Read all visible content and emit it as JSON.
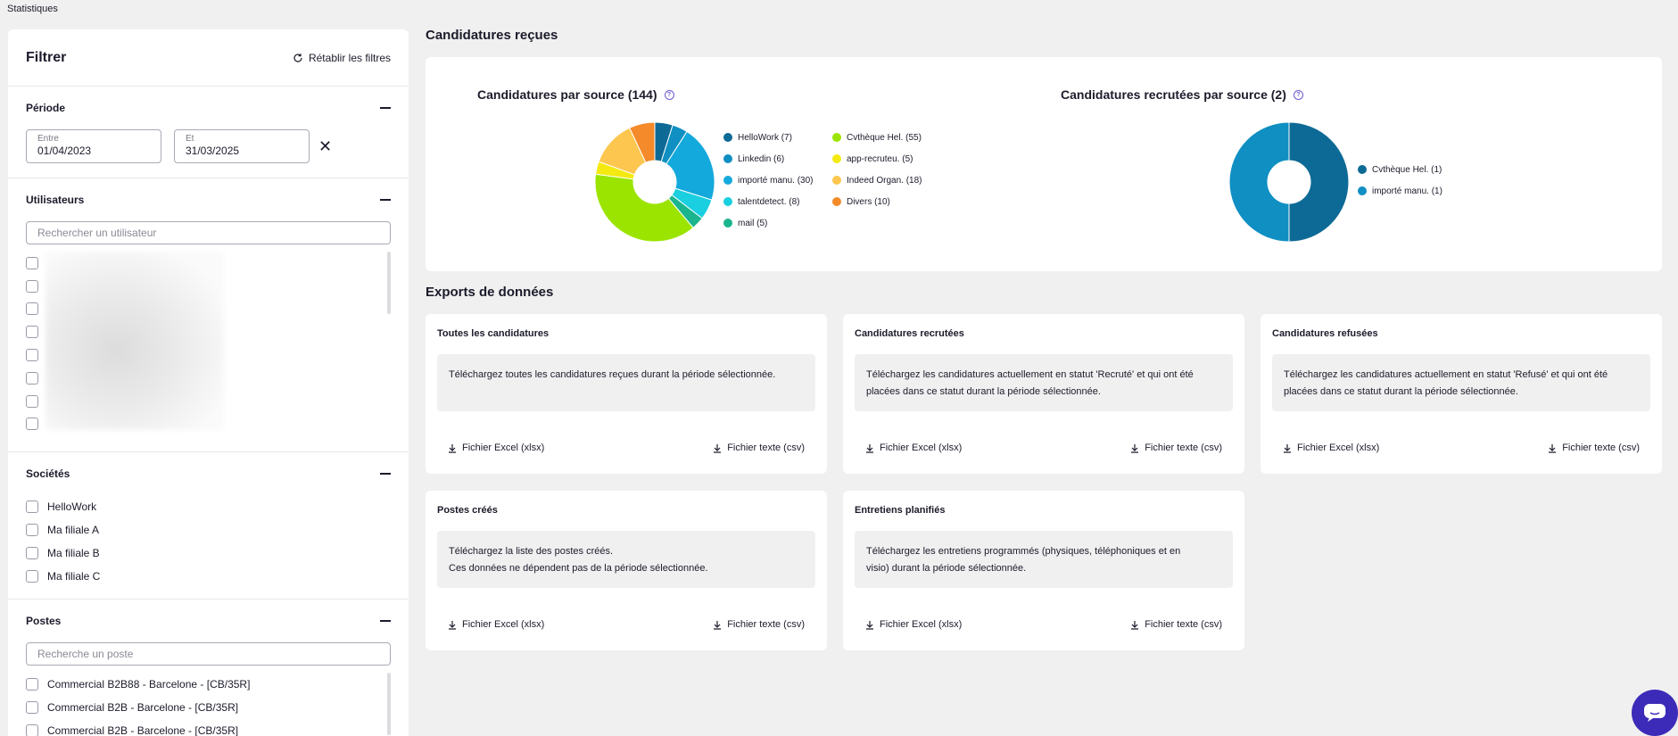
{
  "app": {
    "title": "Statistiques"
  },
  "filters": {
    "title": "Filtrer",
    "reset_label": "Rétablir les filtres",
    "period": {
      "title": "Période",
      "start_label": "Entre",
      "start_value": "01/04/2023",
      "end_label": "Et",
      "end_value": "31/03/2025"
    },
    "users": {
      "title": "Utilisateurs",
      "search_placeholder": "Rechercher un utilisateur"
    },
    "companies": {
      "title": "Sociétés",
      "items": [
        "HelloWork",
        "Ma filiale A",
        "Ma filiale B",
        "Ma filiale C"
      ]
    },
    "postes": {
      "title": "Postes",
      "search_placeholder": "Recherche un poste",
      "items": [
        "Commercial B2B88 - Barcelone - [CB/35R]",
        "Commercial B2B - Barcelone - [CB/35R]",
        "Commercial B2B - Barcelone - [CB/35R]"
      ]
    }
  },
  "received": {
    "section_title": "Candidatures reçues",
    "by_source_title": "Candidatures par source (144)",
    "recruited_title": "Candidatures recrutées par source (2)"
  },
  "exports": {
    "section_title": "Exports de données",
    "excel_label": "Fichier Excel (xlsx)",
    "csv_label": "Fichier texte (csv)",
    "cards": [
      {
        "title": "Toutes les candidatures",
        "desc1": "Téléchargez toutes les candidatures reçues durant la période sélectionnée.",
        "desc2": ""
      },
      {
        "title": "Candidatures recrutées",
        "desc1": "Téléchargez les candidatures actuellement en statut 'Recruté' et qui ont été",
        "desc2": "placées dans ce statut durant la période sélectionnée."
      },
      {
        "title": "Candidatures refusées",
        "desc1": "Téléchargez les candidatures actuellement en statut 'Refusé' et qui ont été",
        "desc2": "placées dans ce statut durant la période sélectionnée."
      },
      {
        "title": "Postes créés",
        "desc1": "Téléchargez la liste des postes créés.",
        "desc2": "Ces données ne dépendent pas de la période sélectionnée."
      },
      {
        "title": "Entretiens planifiés",
        "desc1": "Téléchargez les entretiens programmés (physiques, téléphoniques et en",
        "desc2": "visio) durant la période sélectionnée."
      }
    ]
  },
  "chart_data": [
    {
      "type": "pie",
      "title": "Candidatures par source (144)",
      "donut": true,
      "legend_position": "right",
      "series": [
        {
          "name": "HelloWork",
          "label": "HelloWork (7)",
          "value": 7,
          "color": "#0d6a96"
        },
        {
          "name": "Linkedin",
          "label": "Linkedin (6)",
          "value": 6,
          "color": "#0f8fc2"
        },
        {
          "name": "importé manu.",
          "label": "importé manu. (30)",
          "value": 30,
          "color": "#14a9dc"
        },
        {
          "name": "talentdetect.",
          "label": "talentdetect. (8)",
          "value": 8,
          "color": "#19cfe0"
        },
        {
          "name": "mail",
          "label": "mail (5)",
          "value": 5,
          "color": "#1ab58d"
        },
        {
          "name": "Cvthèque Hel.",
          "label": "Cvthèque Hel. (55)",
          "value": 55,
          "color": "#9be400"
        },
        {
          "name": "app-recruteu.",
          "label": "app-recruteu. (5)",
          "value": 5,
          "color": "#f4ea12"
        },
        {
          "name": "Indeed Organ.",
          "label": "Indeed Organ. (18)",
          "value": 18,
          "color": "#fcc64f"
        },
        {
          "name": "Divers",
          "label": "Divers (10)",
          "value": 10,
          "color": "#f58a2a"
        }
      ]
    },
    {
      "type": "pie",
      "title": "Candidatures recrutées par source (2)",
      "donut": true,
      "legend_position": "right",
      "series": [
        {
          "name": "Cvthèque Hel.",
          "label": "Cvthèque Hel. (1)",
          "value": 1,
          "color": "#0d6a96"
        },
        {
          "name": "importé manu.",
          "label": "importé manu. (1)",
          "value": 1,
          "color": "#0f8fc2"
        }
      ]
    }
  ],
  "icons": {
    "reset": "refresh-icon",
    "collapse": "minus-icon",
    "clear": "close-icon",
    "help": "help-icon",
    "download": "download-icon",
    "chat": "chat-icon"
  },
  "colors": {
    "accent": "#3c2bb8",
    "help": "#6b5bd1"
  }
}
